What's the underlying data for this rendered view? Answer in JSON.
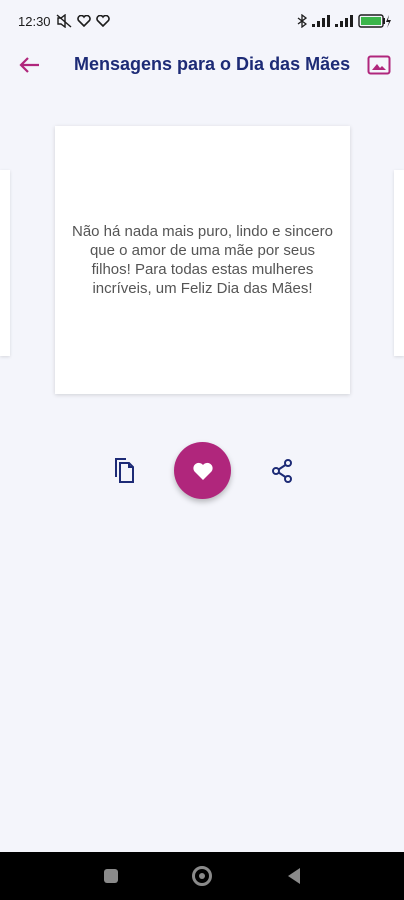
{
  "status_bar": {
    "time": "12:30",
    "battery_icon": "battery-charging-icon"
  },
  "app_bar": {
    "title": "Mensagens para o Dia das Mães",
    "back_icon": "arrow-left-icon",
    "image_icon": "image-icon"
  },
  "message": {
    "text": "Não há nada mais puro, lindo e sincero que o amor de uma mãe por seus filhos! Para todas estas mulheres incríveis, um Feliz Dia das Mães!"
  },
  "actions": {
    "copy_icon": "copy-icon",
    "favorite_icon": "heart-icon",
    "share_icon": "share-icon"
  },
  "colors": {
    "accent": "#b0267c",
    "title": "#1d2b76",
    "background": "#f4f5fb",
    "icon": "#1d2b76"
  }
}
